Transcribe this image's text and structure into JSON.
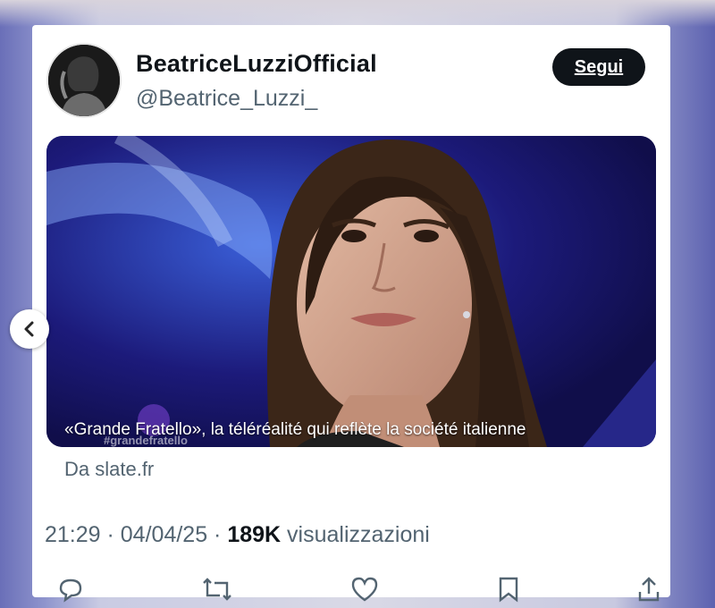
{
  "post": {
    "display_name": "BeatriceLuzziOfficial",
    "handle": "@Beatrice_Luzzi_",
    "follow_label": "Segui",
    "media": {
      "caption": "«Grande Fratello», la téléréalité qui reflète la société italienne",
      "watermark": "#grandefratello"
    },
    "link_source": "Da slate.fr",
    "time": "21:29",
    "separator": " · ",
    "date": "04/04/25",
    "views_count": "189K",
    "views_label": "visualizzazioni"
  },
  "icons": {
    "avatar": "avatar-silhouette",
    "carousel_prev": "chevron-left-icon",
    "actions": [
      "reply-icon",
      "retweet-icon",
      "like-icon",
      "bookmark-icon",
      "share-icon"
    ]
  },
  "colors": {
    "text_primary": "#0f1419",
    "text_secondary": "#536471",
    "button_bg": "#0f1419",
    "card_bg": "#ffffff",
    "media_bg": "#17155e"
  }
}
